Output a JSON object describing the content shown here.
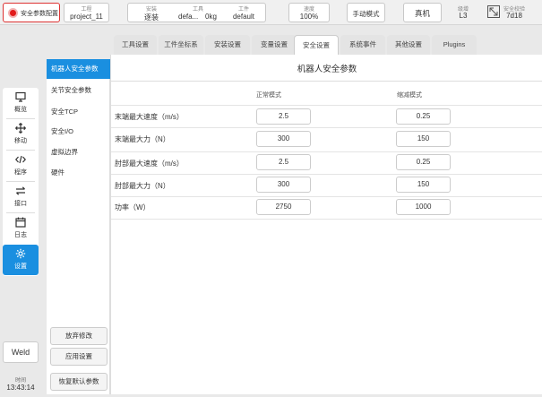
{
  "topbar": {
    "safety_label": "安全参数配置",
    "project": {
      "label": "工程",
      "value": "project_11"
    },
    "install": {
      "label": "安装",
      "value": "逐装"
    },
    "tool": {
      "label": "工具",
      "value": "defa...",
      "load": "0kg"
    },
    "workpiece": {
      "label": "工件",
      "value": "default"
    },
    "speed": {
      "label": "速度",
      "value": "100%"
    },
    "mode_label": "手动模式",
    "robot_label": "真机",
    "level": {
      "label": "级增",
      "value": "L3"
    },
    "checksum": {
      "label": "安全校验",
      "value": "7d18"
    }
  },
  "tabs": [
    {
      "label": "工具设置"
    },
    {
      "label": "工件坐标系"
    },
    {
      "label": "安装设置"
    },
    {
      "label": "变量设置"
    },
    {
      "label": "安全设置"
    },
    {
      "label": "系统事件"
    },
    {
      "label": "其他设置"
    },
    {
      "label": "Plugins"
    }
  ],
  "nav": [
    {
      "label": "概览",
      "icon": "monitor-icon"
    },
    {
      "label": "移动",
      "icon": "move-arrows-icon"
    },
    {
      "label": "程序",
      "icon": "code-icon"
    },
    {
      "label": "接口",
      "icon": "swap-arrows-icon"
    },
    {
      "label": "日志",
      "icon": "calendar-icon"
    },
    {
      "label": "设置",
      "icon": "gear-icon"
    }
  ],
  "weld_label": "Weld",
  "clock": {
    "label": "时间",
    "value": "13:43:14"
  },
  "submenu": {
    "items": [
      {
        "label": "机器人安全参数"
      },
      {
        "label": "关节安全参数"
      },
      {
        "label": "安全TCP"
      },
      {
        "label": "安全I/O"
      },
      {
        "label": "虚拟边界"
      },
      {
        "label": "硬件"
      }
    ],
    "discard_label": "放弃修改",
    "apply_label": "应用设置",
    "restore_label": "恢复默认参数"
  },
  "main": {
    "title": "机器人安全参数",
    "col_normal": "正常模式",
    "col_reduced": "缩减模式",
    "rows": [
      {
        "label": "末端最大速度（m/s）",
        "normal": "2.5",
        "reduced": "0.25"
      },
      {
        "label": "末端最大力（N）",
        "normal": "300",
        "reduced": "150"
      },
      {
        "label": "肘部最大速度（m/s）",
        "normal": "2.5",
        "reduced": "0.25"
      },
      {
        "label": "肘部最大力（N）",
        "normal": "300",
        "reduced": "150"
      },
      {
        "label": "功率（W）",
        "normal": "2750",
        "reduced": "1000"
      }
    ]
  },
  "colors": {
    "accent": "#1a8fe0",
    "safety_red": "#e21b1b"
  }
}
